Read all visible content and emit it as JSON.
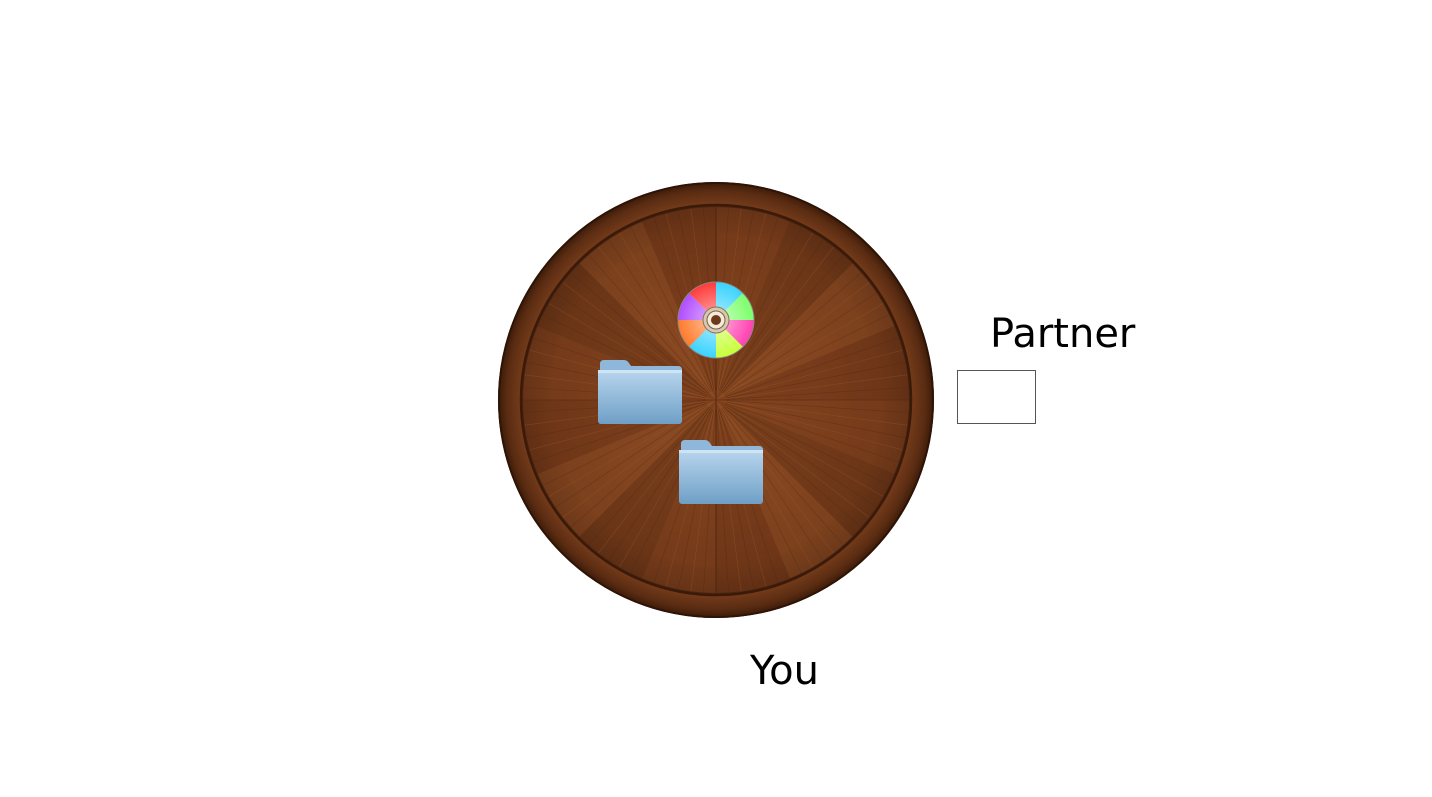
{
  "labels": {
    "partner": "Partner",
    "you": "You"
  },
  "table": {
    "material": "wood",
    "colors": {
      "base": "#6e3a1c",
      "light": "#9a5a2e",
      "dark": "#3f1f0c",
      "rim": "#4a250f"
    }
  },
  "items": [
    {
      "name": "disc",
      "icon": "cd-disc-icon"
    },
    {
      "name": "folder",
      "icon": "folder-icon"
    },
    {
      "name": "folder",
      "icon": "folder-icon"
    }
  ],
  "partner_slot": {
    "icon": "empty-box"
  },
  "colors": {
    "folder_light": "#a9cbe6",
    "folder_dark": "#6f9fc6",
    "text": "#000000"
  }
}
